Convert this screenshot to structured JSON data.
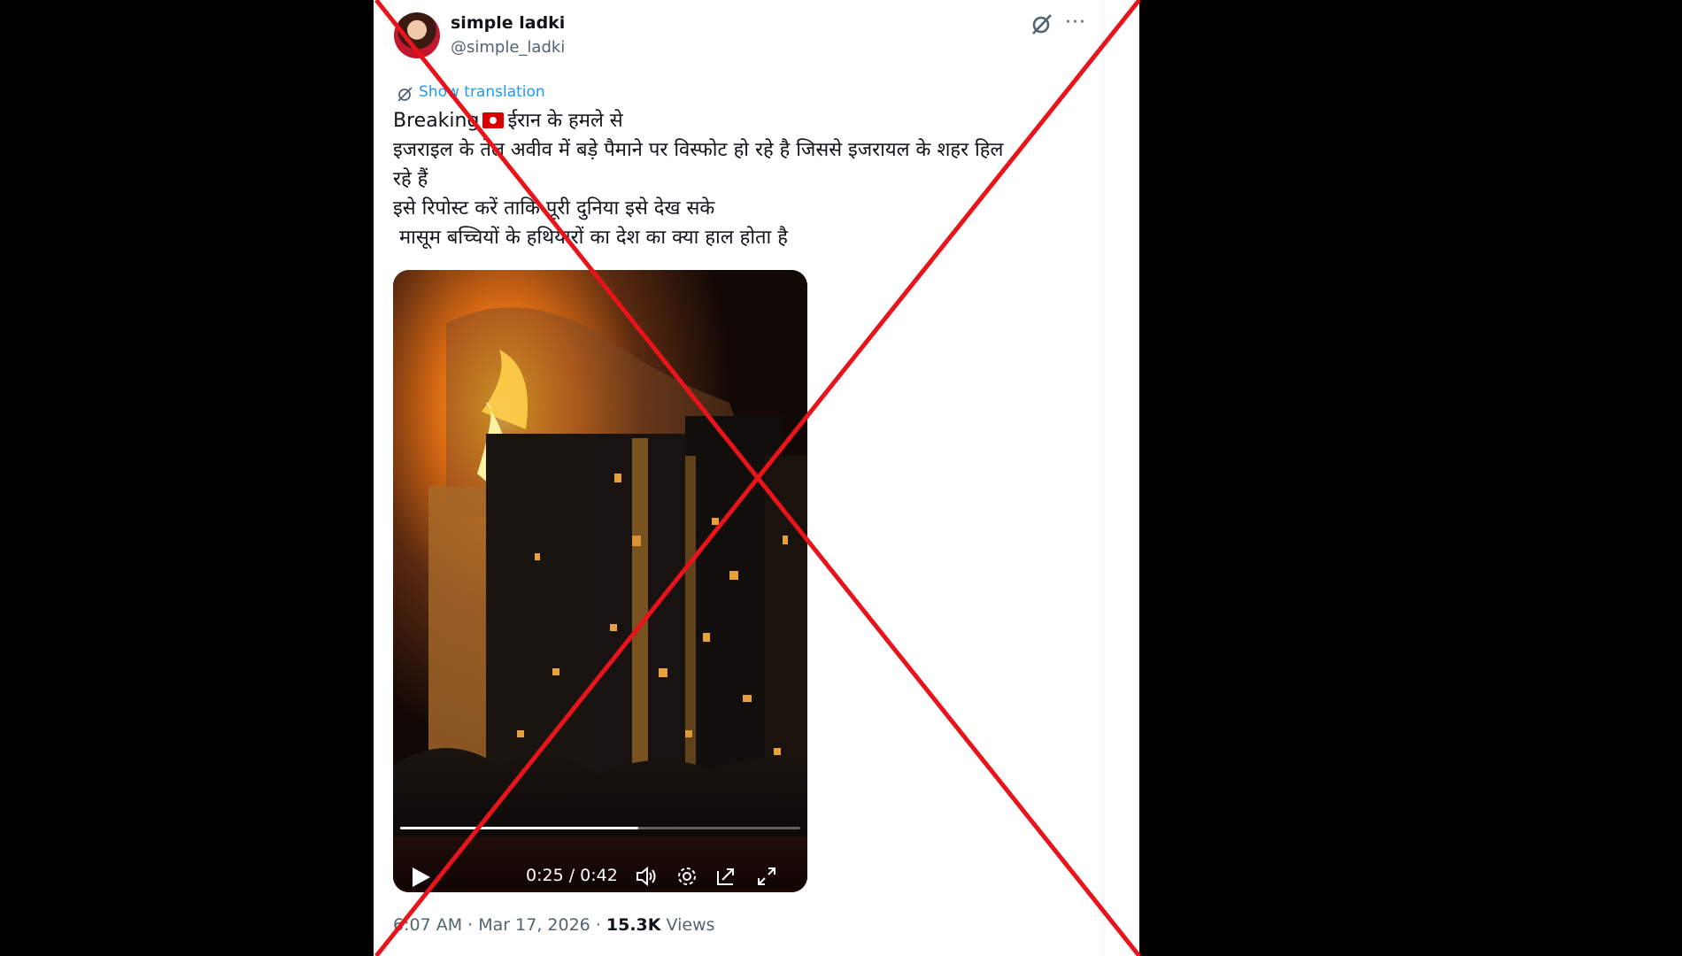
{
  "tweet": {
    "display_name": "simple ladki",
    "handle": "@simple_ladki",
    "show_translation": "Show translation",
    "text_lines": [
      "Breaking",
      "ईरान के हमले से",
      "इजराइल के तेल अवीव में बड़े पैमाने पर विस्फोट हो रहे है जिससे इजरायल के शहर हिल",
      "रहे हैं",
      "इसे रिपोस्ट करें ताकि पूरी दुनिया इसे देख सके",
      " मासूम बच्चियों के हथियारों का देश का क्या हाल होता है"
    ],
    "flag_icon": "iran-flag-icon",
    "time": "6:07 AM",
    "separator": "·",
    "date": "Mar 17, 2026",
    "views_count": "15.3K",
    "views_label": "Views"
  },
  "video": {
    "time_readout": "0:25 / 0:42",
    "progress_fraction": 0.595
  },
  "icons": {
    "grok": "grok-icon",
    "more": "more-icon",
    "translate": "translate-icon",
    "play": "play-icon",
    "volume": "volume-icon",
    "settings": "settings-icon",
    "pip": "picture-in-picture-icon",
    "fullscreen": "fullscreen-icon"
  },
  "colors": {
    "link": "#1d9bf0",
    "overlay_cross": "#e8141b",
    "secondary_text": "#536471"
  }
}
